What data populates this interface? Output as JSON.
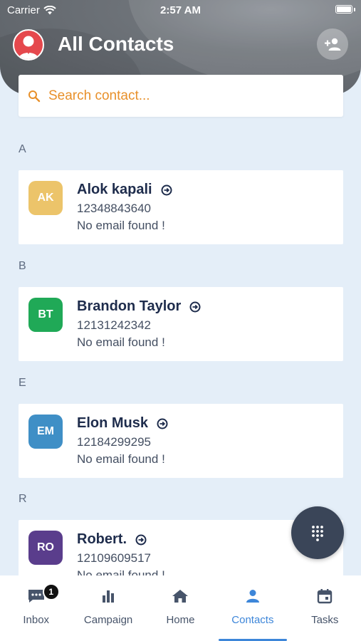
{
  "status_bar": {
    "carrier": "Carrier",
    "time": "2:57 AM"
  },
  "header": {
    "title": "All Contacts"
  },
  "search": {
    "placeholder": "Search contact..."
  },
  "sections": [
    {
      "letter": "A",
      "contacts": [
        {
          "initials": "AK",
          "name": "Alok kapali",
          "phone": "12348843640",
          "email": "No email found !",
          "color": "#ecc46a"
        }
      ]
    },
    {
      "letter": "B",
      "contacts": [
        {
          "initials": "BT",
          "name": "Brandon Taylor",
          "phone": "12131242342",
          "email": "No email found !",
          "color": "#20a957"
        }
      ]
    },
    {
      "letter": "E",
      "contacts": [
        {
          "initials": "EM",
          "name": "Elon Musk",
          "phone": "12184299295",
          "email": "No email found !",
          "color": "#3f8fc6"
        }
      ]
    },
    {
      "letter": "R",
      "contacts": [
        {
          "initials": "RO",
          "name": "Robert.",
          "phone": "12109609517",
          "email": "No email found !",
          "color": "#5a3d8c"
        }
      ]
    }
  ],
  "tabs": [
    {
      "label": "Inbox",
      "icon": "chat-icon",
      "badge": "1"
    },
    {
      "label": "Campaign",
      "icon": "bar-chart-icon"
    },
    {
      "label": "Home",
      "icon": "home-icon"
    },
    {
      "label": "Contacts",
      "icon": "person-icon",
      "active": true
    },
    {
      "label": "Tasks",
      "icon": "calendar-icon"
    }
  ],
  "colors": {
    "accent": "#3d86d9",
    "search_placeholder": "#e8902a",
    "fab": "#3a4558"
  }
}
